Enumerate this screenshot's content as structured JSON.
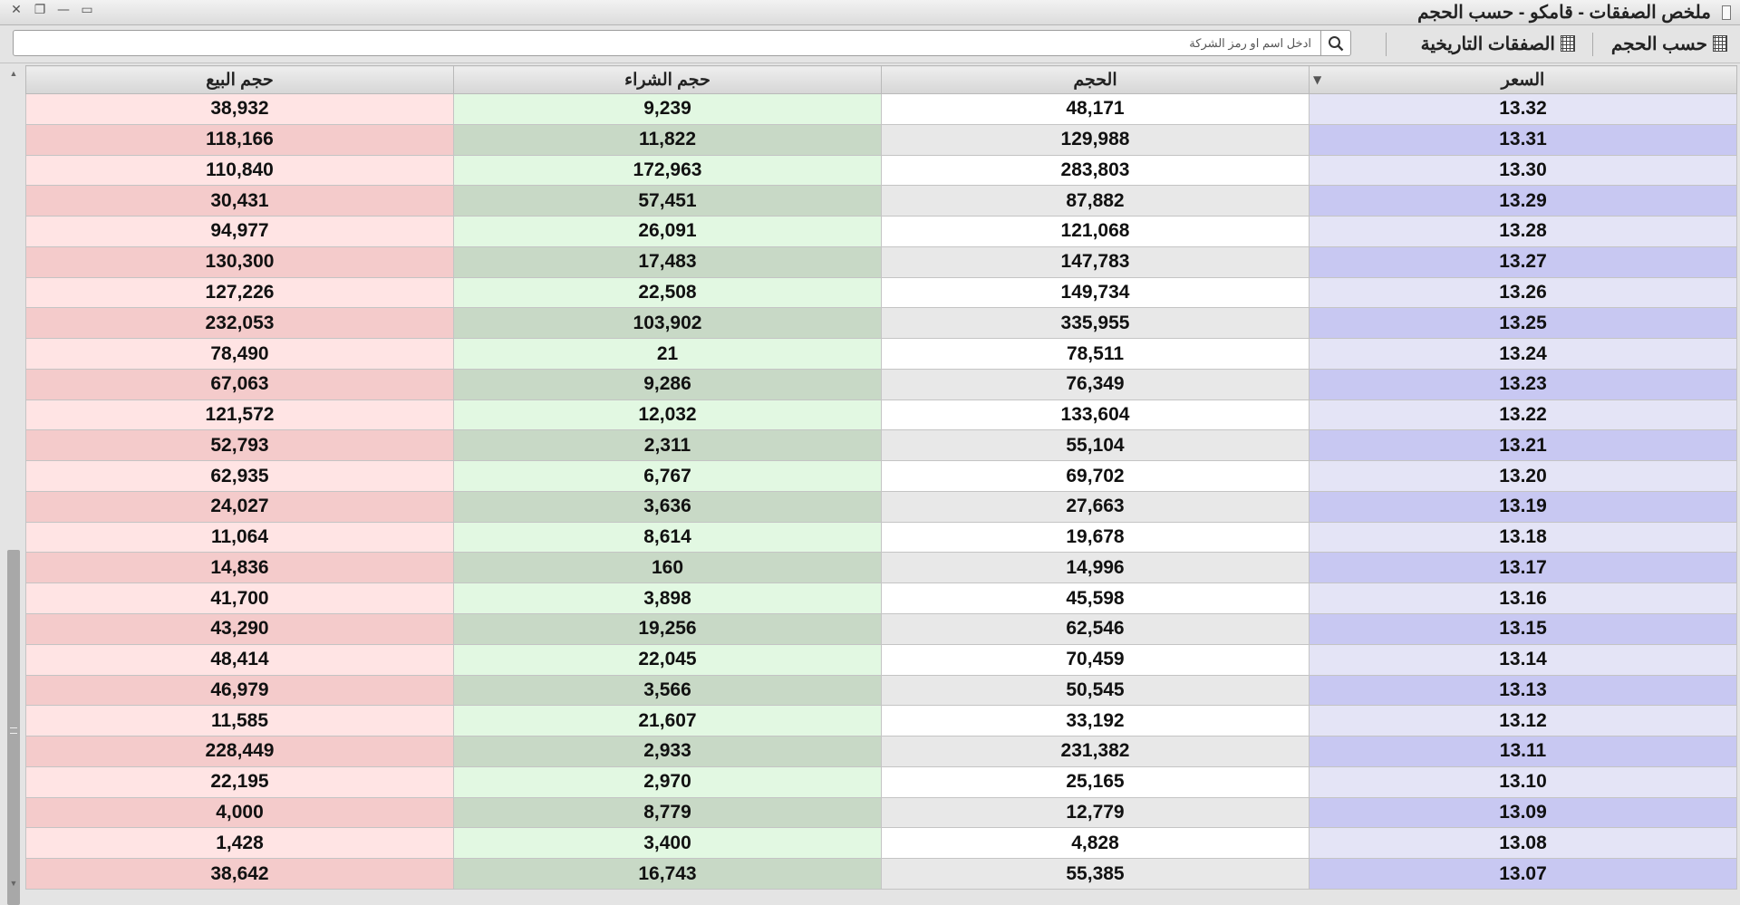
{
  "window": {
    "title": "ملخص الصفقات - قامكو - حسب الحجم",
    "controls": [
      "✕",
      "❐",
      "—",
      "▭"
    ]
  },
  "toolbar": {
    "by_volume_label": "حسب الحجم",
    "historical_trades_label": "الصفقات التاريخية",
    "search_placeholder": "ادخل اسم او رمز الشركة"
  },
  "table": {
    "columns": [
      "حجم البيع",
      "حجم الشراء",
      "الحجم",
      "السعر"
    ],
    "sort_indicator": "▼",
    "rows": [
      {
        "sell": "38,932",
        "buy": "9,239",
        "volume": "48,171",
        "price": "13.32"
      },
      {
        "sell": "118,166",
        "buy": "11,822",
        "volume": "129,988",
        "price": "13.31"
      },
      {
        "sell": "110,840",
        "buy": "172,963",
        "volume": "283,803",
        "price": "13.30"
      },
      {
        "sell": "30,431",
        "buy": "57,451",
        "volume": "87,882",
        "price": "13.29"
      },
      {
        "sell": "94,977",
        "buy": "26,091",
        "volume": "121,068",
        "price": "13.28"
      },
      {
        "sell": "130,300",
        "buy": "17,483",
        "volume": "147,783",
        "price": "13.27"
      },
      {
        "sell": "127,226",
        "buy": "22,508",
        "volume": "149,734",
        "price": "13.26"
      },
      {
        "sell": "232,053",
        "buy": "103,902",
        "volume": "335,955",
        "price": "13.25"
      },
      {
        "sell": "78,490",
        "buy": "21",
        "volume": "78,511",
        "price": "13.24"
      },
      {
        "sell": "67,063",
        "buy": "9,286",
        "volume": "76,349",
        "price": "13.23"
      },
      {
        "sell": "121,572",
        "buy": "12,032",
        "volume": "133,604",
        "price": "13.22"
      },
      {
        "sell": "52,793",
        "buy": "2,311",
        "volume": "55,104",
        "price": "13.21"
      },
      {
        "sell": "62,935",
        "buy": "6,767",
        "volume": "69,702",
        "price": "13.20"
      },
      {
        "sell": "24,027",
        "buy": "3,636",
        "volume": "27,663",
        "price": "13.19"
      },
      {
        "sell": "11,064",
        "buy": "8,614",
        "volume": "19,678",
        "price": "13.18"
      },
      {
        "sell": "14,836",
        "buy": "160",
        "volume": "14,996",
        "price": "13.17"
      },
      {
        "sell": "41,700",
        "buy": "3,898",
        "volume": "45,598",
        "price": "13.16"
      },
      {
        "sell": "43,290",
        "buy": "19,256",
        "volume": "62,546",
        "price": "13.15"
      },
      {
        "sell": "48,414",
        "buy": "22,045",
        "volume": "70,459",
        "price": "13.14"
      },
      {
        "sell": "46,979",
        "buy": "3,566",
        "volume": "50,545",
        "price": "13.13"
      },
      {
        "sell": "11,585",
        "buy": "21,607",
        "volume": "33,192",
        "price": "13.12"
      },
      {
        "sell": "228,449",
        "buy": "2,933",
        "volume": "231,382",
        "price": "13.11"
      },
      {
        "sell": "22,195",
        "buy": "2,970",
        "volume": "25,165",
        "price": "13.10"
      },
      {
        "sell": "4,000",
        "buy": "8,779",
        "volume": "12,779",
        "price": "13.09"
      },
      {
        "sell": "1,428",
        "buy": "3,400",
        "volume": "4,828",
        "price": "13.08"
      },
      {
        "sell": "38,642",
        "buy": "16,743",
        "volume": "55,385",
        "price": "13.07"
      }
    ]
  },
  "colors": {
    "sell_light": "#ffe4e4",
    "sell_dark": "#f4cbcb",
    "buy_light": "#e2f8e2",
    "buy_dark": "#c8d9c6",
    "price_light": "#e4e4f6",
    "price_dark": "#c8c8f2"
  }
}
